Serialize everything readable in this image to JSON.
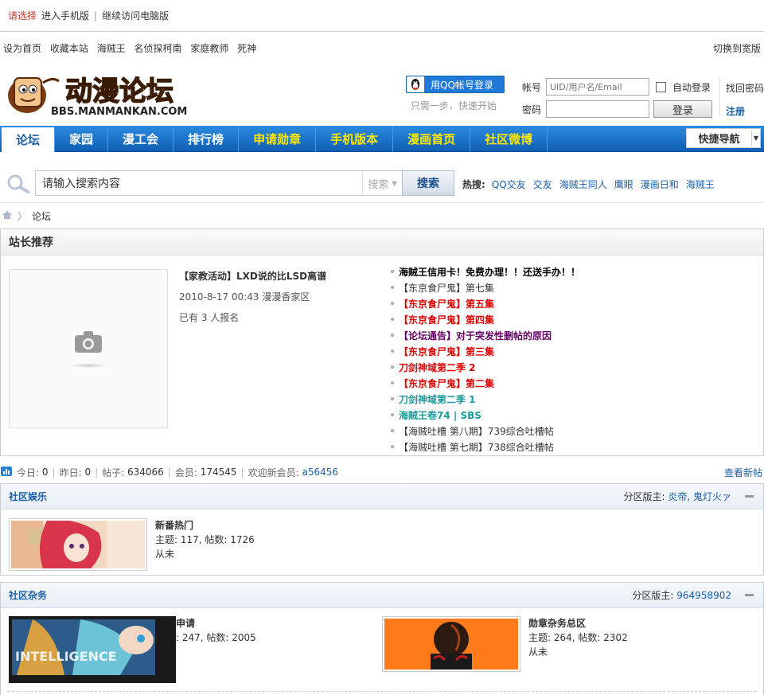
{
  "choosebar": {
    "hint": "请选择",
    "mobile": "进入手机版",
    "desktop": "继续访问电脑版"
  },
  "toplinks": {
    "items": [
      "设为首页",
      "收藏本站",
      "海贼王",
      "名侦探柯南",
      "家庭教师",
      "死神"
    ],
    "wide": "切换到宽版"
  },
  "login": {
    "qq_button": "用QQ帐号登录",
    "qq_hint": "只需一步，快速开始",
    "account_label": "帐号",
    "account_placeholder": "UID/用户名/Email",
    "password_label": "密码",
    "auto_login": "自动登录",
    "login_button": "登录",
    "forgot": "找回密码",
    "register": "注册"
  },
  "nav": {
    "items": [
      "论坛",
      "家园",
      "漫工会",
      "排行榜",
      "申请勋章",
      "手机版本",
      "漫画首页",
      "社区微博"
    ],
    "quick": "快捷导航"
  },
  "search": {
    "placeholder": "请输入搜索内容",
    "type": "搜索",
    "button": "搜索",
    "hot_label": "热搜:",
    "hot": [
      "QQ交友",
      "交友",
      "海贼王同人",
      "鹰眼",
      "漫画日和",
      "海贼王"
    ]
  },
  "breadcrumb": {
    "current": "论坛"
  },
  "recommend": {
    "title": "站长推荐",
    "event_title": "【家教活动】LXD说的比LSD离谱",
    "event_time": "2010-8-17 00:43 漫漫香家区",
    "event_count": "已有 3 人报名",
    "list": [
      {
        "text": "海贼王信用卡！免费办理！！还送手办！！",
        "color": "#000000",
        "bold": true
      },
      {
        "text": "【东京食尸鬼】第七集",
        "color": "#333333",
        "bold": false
      },
      {
        "text": "【东京食尸鬼】第五集",
        "color": "#e00000",
        "bold": true
      },
      {
        "text": "【东京食尸鬼】第四集",
        "color": "#e00000",
        "bold": true
      },
      {
        "text": "【论坛通告】对于突发性删帖的原因",
        "color": "#660066",
        "bold": true
      },
      {
        "text": "【东京食尸鬼】第三集",
        "color": "#e00000",
        "bold": true
      },
      {
        "text": "刀剑神域第二季 2",
        "color": "#e00000",
        "bold": true
      },
      {
        "text": "【东京食尸鬼】第二集",
        "color": "#e00000",
        "bold": true
      },
      {
        "text": "刀剑神域第二季 1",
        "color": "#1a9c9c",
        "bold": true
      },
      {
        "text": "海贼王卷74 | SBS",
        "color": "#1a9c9c",
        "bold": true
      },
      {
        "text": "【海贼吐槽 第八期】739综合吐槽帖",
        "color": "#333333",
        "bold": false
      },
      {
        "text": "【海贼吐槽 第七期】738综合吐槽帖",
        "color": "#333333",
        "bold": false
      }
    ]
  },
  "stats": {
    "today_label": "今日:",
    "today": "0",
    "yesterday_label": "昨日:",
    "yesterday": "0",
    "posts_label": "帖子:",
    "posts": "634066",
    "members_label": "会员:",
    "members": "174545",
    "welcome_label": "欢迎新会员:",
    "new_member": "a56456",
    "view_new": "查看新帖"
  },
  "sections": [
    {
      "title": "社区娱乐",
      "mods_label": "分区版主:",
      "mods": "炎帝, 鬼灯火ァ",
      "forums": [
        {
          "name": "新番热门",
          "stats": "主题: 117, 帖数: 1726",
          "last": "从未"
        }
      ]
    },
    {
      "title": "社区杂务",
      "mods_label": "分区版主:",
      "mods": "964958902",
      "forums": [
        {
          "name": "申请",
          "stats": ": 247, 帖数: 2005",
          "last": ""
        },
        {
          "name": "勋章杂务总区",
          "stats": "主题: 264, 帖数: 2302",
          "last": "从未"
        }
      ]
    }
  ],
  "colors": {
    "nav_blue": "#1b6fc8",
    "nav_highlight": "#ffe600",
    "link": "#1b5fa8"
  }
}
